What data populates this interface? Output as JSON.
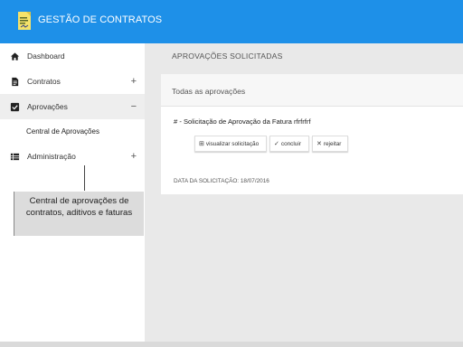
{
  "header": {
    "title": "GESTÃO DE CONTRATOS",
    "logo_icon": "contract-document-icon",
    "bg_color": "#1e90e8"
  },
  "sidebar": {
    "items": [
      {
        "label": "Dashboard",
        "icon": "home-icon"
      },
      {
        "label": "Contratos",
        "icon": "document-icon",
        "expander": "+"
      },
      {
        "label": "Aprovações",
        "icon": "checkbox-icon",
        "expander": "−",
        "active": true
      },
      {
        "label": "Administração",
        "icon": "list-icon",
        "expander": "+"
      }
    ],
    "subitems": [
      {
        "label": "Central de Aprovações"
      }
    ]
  },
  "tooltip": {
    "text": "Central de aprovações de contratos, aditivos e faturas"
  },
  "main": {
    "page_title": "APROVAÇÕES SOLICITADAS",
    "card_header": "Todas as aprovações",
    "item": {
      "title": "# - Solicitação de Aprovação da Fatura rfrfrfrf",
      "actions": [
        {
          "label": "visualizar solicitação",
          "icon": "grid-icon"
        },
        {
          "label": "concluir",
          "icon": "check-icon"
        },
        {
          "label": "rejeitar",
          "icon": "close-icon"
        }
      ],
      "date_text": "DATA DA SOLICITAÇÃO: 18/07/2016"
    }
  }
}
